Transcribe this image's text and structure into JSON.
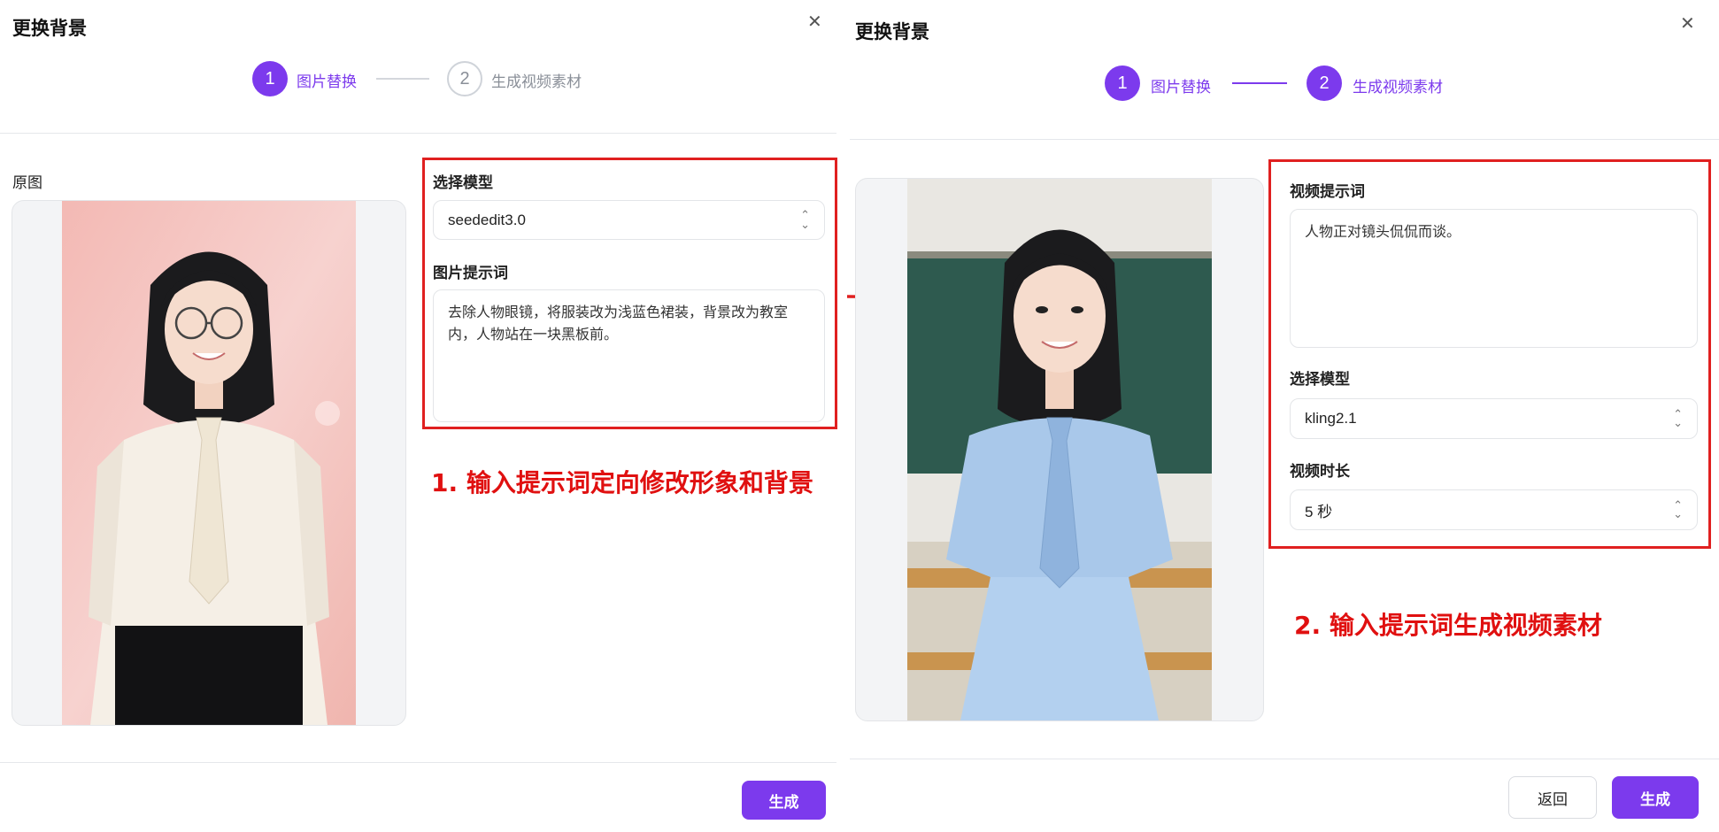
{
  "left": {
    "title": "更换背景",
    "steps": [
      {
        "num": "1",
        "label": "图片替换"
      },
      {
        "num": "2",
        "label": "生成视频素材"
      }
    ],
    "original_label": "原图",
    "model_label": "选择模型",
    "model_value": "seededit3.0",
    "prompt_label": "图片提示词",
    "prompt_value": "去除人物眼镜，将服装改为浅蓝色裙装，背景改为教室内，人物站在一块黑板前。",
    "annotation": "1. 输入提示词定向修改形象和背景",
    "generate_button": "生成"
  },
  "right": {
    "title": "更换背景",
    "steps": [
      {
        "num": "1",
        "label": "图片替换"
      },
      {
        "num": "2",
        "label": "生成视频素材"
      }
    ],
    "video_prompt_label": "视频提示词",
    "video_prompt_value": "人物正对镜头侃侃而谈。",
    "model_label": "选择模型",
    "model_value": "kling2.1",
    "duration_label": "视频时长",
    "duration_value": "5 秒",
    "annotation": "2. 输入提示词生成视频素材",
    "back_button": "返回",
    "generate_button": "生成"
  },
  "colors": {
    "accent": "#7c3aed",
    "annotation_red": "#e02020"
  }
}
